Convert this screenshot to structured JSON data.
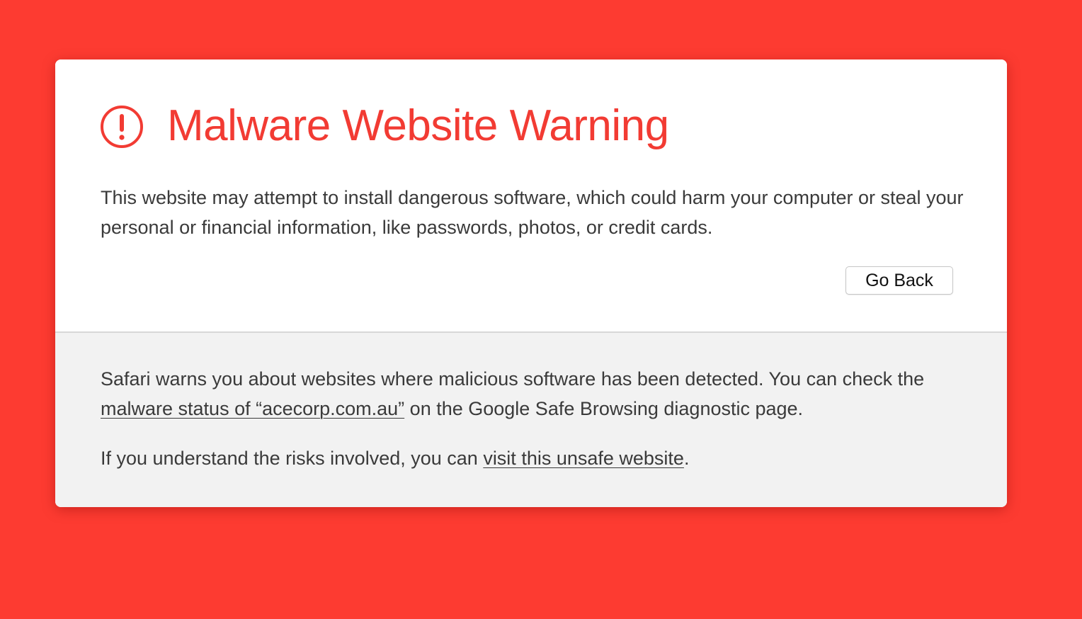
{
  "page": {
    "background_color": "#fd3b31",
    "accent_color": "#f23b33"
  },
  "warning": {
    "icon": "exclamation-circle-icon",
    "title": "Malware Website Warning",
    "description": "This website may attempt to install dangerous software, which could harm your computer or steal your personal or financial information, like passwords, photos, or credit cards.",
    "go_back_label": "Go Back"
  },
  "details": {
    "paragraph1_before": "Safari warns you about websites where malicious software has been detected. You can check the ",
    "paragraph1_link": "malware status of “acecorp.com.au”",
    "paragraph1_after": " on the Google Safe Browsing diagnostic page.",
    "paragraph2_before": "If you understand the risks involved, you can ",
    "paragraph2_link": "visit this unsafe website",
    "paragraph2_after": "."
  }
}
